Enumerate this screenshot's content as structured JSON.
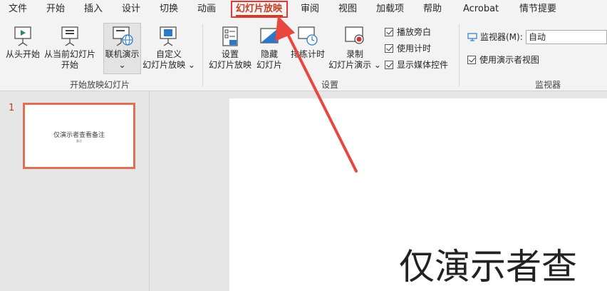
{
  "menu": {
    "tabs": [
      {
        "label": "文件"
      },
      {
        "label": "开始"
      },
      {
        "label": "插入"
      },
      {
        "label": "设计"
      },
      {
        "label": "切换"
      },
      {
        "label": "动画"
      },
      {
        "label": "幻灯片放映"
      },
      {
        "label": "审阅"
      },
      {
        "label": "视图"
      },
      {
        "label": "加载项"
      },
      {
        "label": "帮助"
      },
      {
        "label": "Acrobat"
      },
      {
        "label": "情节提要"
      }
    ],
    "active_index": 6
  },
  "ribbon": {
    "start_group": {
      "label": "开始放映幻灯片",
      "from_beginning": "从头开始",
      "from_current_1": "从当前幻灯片",
      "from_current_2": "开始",
      "online_present": "联机演示",
      "online_chevron": "⌄",
      "custom_1": "自定义",
      "custom_2": "幻灯片放映 ⌄"
    },
    "setup_group": {
      "label": "设置",
      "setup_1": "设置",
      "setup_2": "幻灯片放映",
      "hide_1": "隐藏",
      "hide_2": "幻灯片",
      "rehearse": "排练计时",
      "record_1": "录制",
      "record_2": "幻灯片演示 ⌄",
      "play_narration": "播放旁白",
      "use_timings": "使用计时",
      "show_media": "显示媒体控件"
    },
    "monitor_group": {
      "label": "监视器",
      "monitor_label": "监视器(M):",
      "monitor_value": "自动",
      "presenter_view": "使用演示者视图"
    }
  },
  "slides_pane": {
    "slide_number": "1",
    "thumb_title": "仅演示者查看备注",
    "thumb_sub": "备注"
  },
  "slide": {
    "title": "仅演示者查"
  },
  "colors": {
    "accent": "#c43e1c",
    "highlight": "#e03a3a",
    "thumb_border": "#e07055"
  }
}
